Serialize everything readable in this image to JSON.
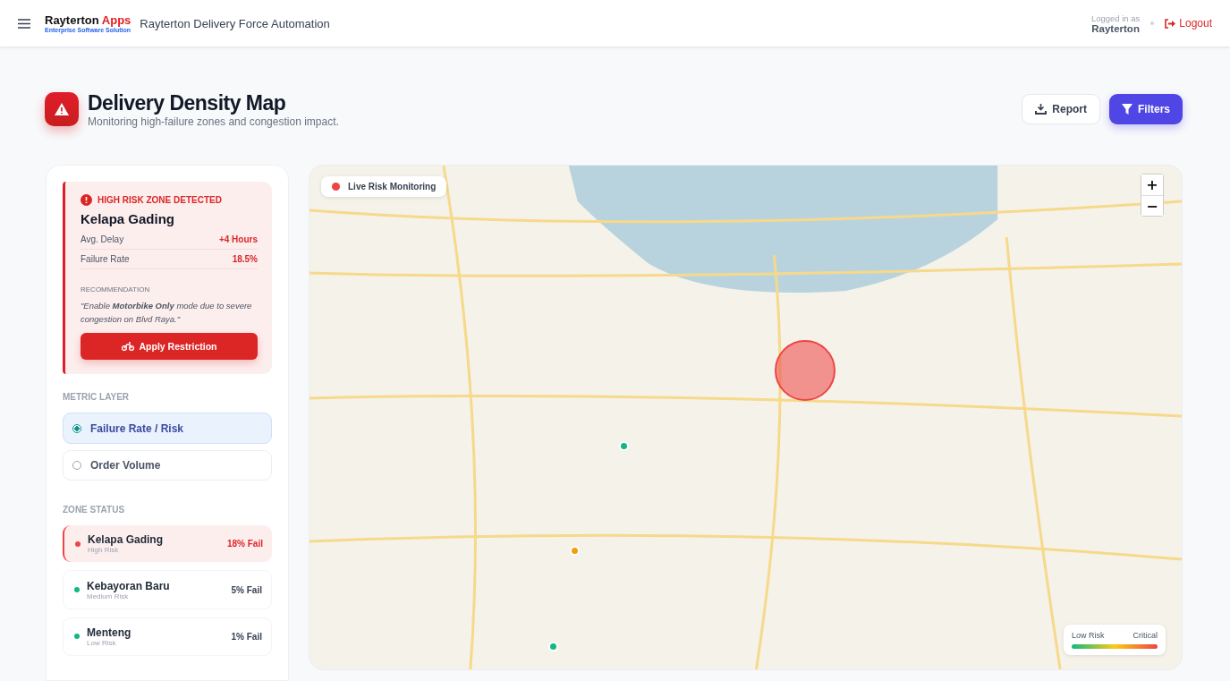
{
  "header": {
    "brand": "Rayterton",
    "brand_accent": "Apps",
    "tagline": "Enterprise Software Solution",
    "app_title": "Rayterton Delivery Force Automation",
    "logged_in_label": "Logged in as",
    "user": "Rayterton",
    "logout": "Logout"
  },
  "page": {
    "title": "Delivery Density Map",
    "subtitle": "Monitoring high-failure zones and congestion impact.",
    "buttons": [
      {
        "kind": "report",
        "label": "Report"
      },
      {
        "kind": "filters",
        "label": "Filters"
      }
    ]
  },
  "alert": {
    "heading": "HIGH RISK ZONE DETECTED",
    "zone": "Kelapa Gading",
    "stats": [
      {
        "label": "Avg. Delay",
        "value": "+4 Hours"
      },
      {
        "label": "Failure Rate",
        "value": "18.5%"
      }
    ],
    "recommendation_label": "RECOMMENDATION",
    "recommendation": "\"Enable **Motorbike Only** mode due to severe congestion on Blvd Raya.\"",
    "action": "Apply Restriction"
  },
  "metric_layer": {
    "heading": "METRIC LAYER",
    "options": [
      {
        "label": "Failure Rate / Risk",
        "selected": true
      },
      {
        "label": "Order Volume",
        "selected": false
      }
    ]
  },
  "zone_status": {
    "heading": "ZONE STATUS",
    "zones": [
      {
        "name": "Kelapa Gading",
        "risk": "High Risk",
        "fail": "18% Fail",
        "color": "#ef4444",
        "selected": true
      },
      {
        "name": "Kebayoran Baru",
        "risk": "Medium Risk",
        "fail": "5% Fail",
        "color": "#10b981",
        "selected": false
      },
      {
        "name": "Menteng",
        "risk": "Low Risk",
        "fail": "1% Fail",
        "color": "#10b981",
        "selected": false
      }
    ]
  },
  "map": {
    "badge": "Live Risk Monitoring",
    "zoom_in": "+",
    "zoom_out": "−",
    "markers": [
      {
        "kind": "zone"
      },
      {
        "kind": "dot",
        "color": "#10b981"
      },
      {
        "kind": "dot",
        "color": "#f59e0b"
      },
      {
        "kind": "dot",
        "color": "#10b981"
      }
    ],
    "legend": {
      "low": "Low Risk",
      "high": "Critical"
    }
  }
}
